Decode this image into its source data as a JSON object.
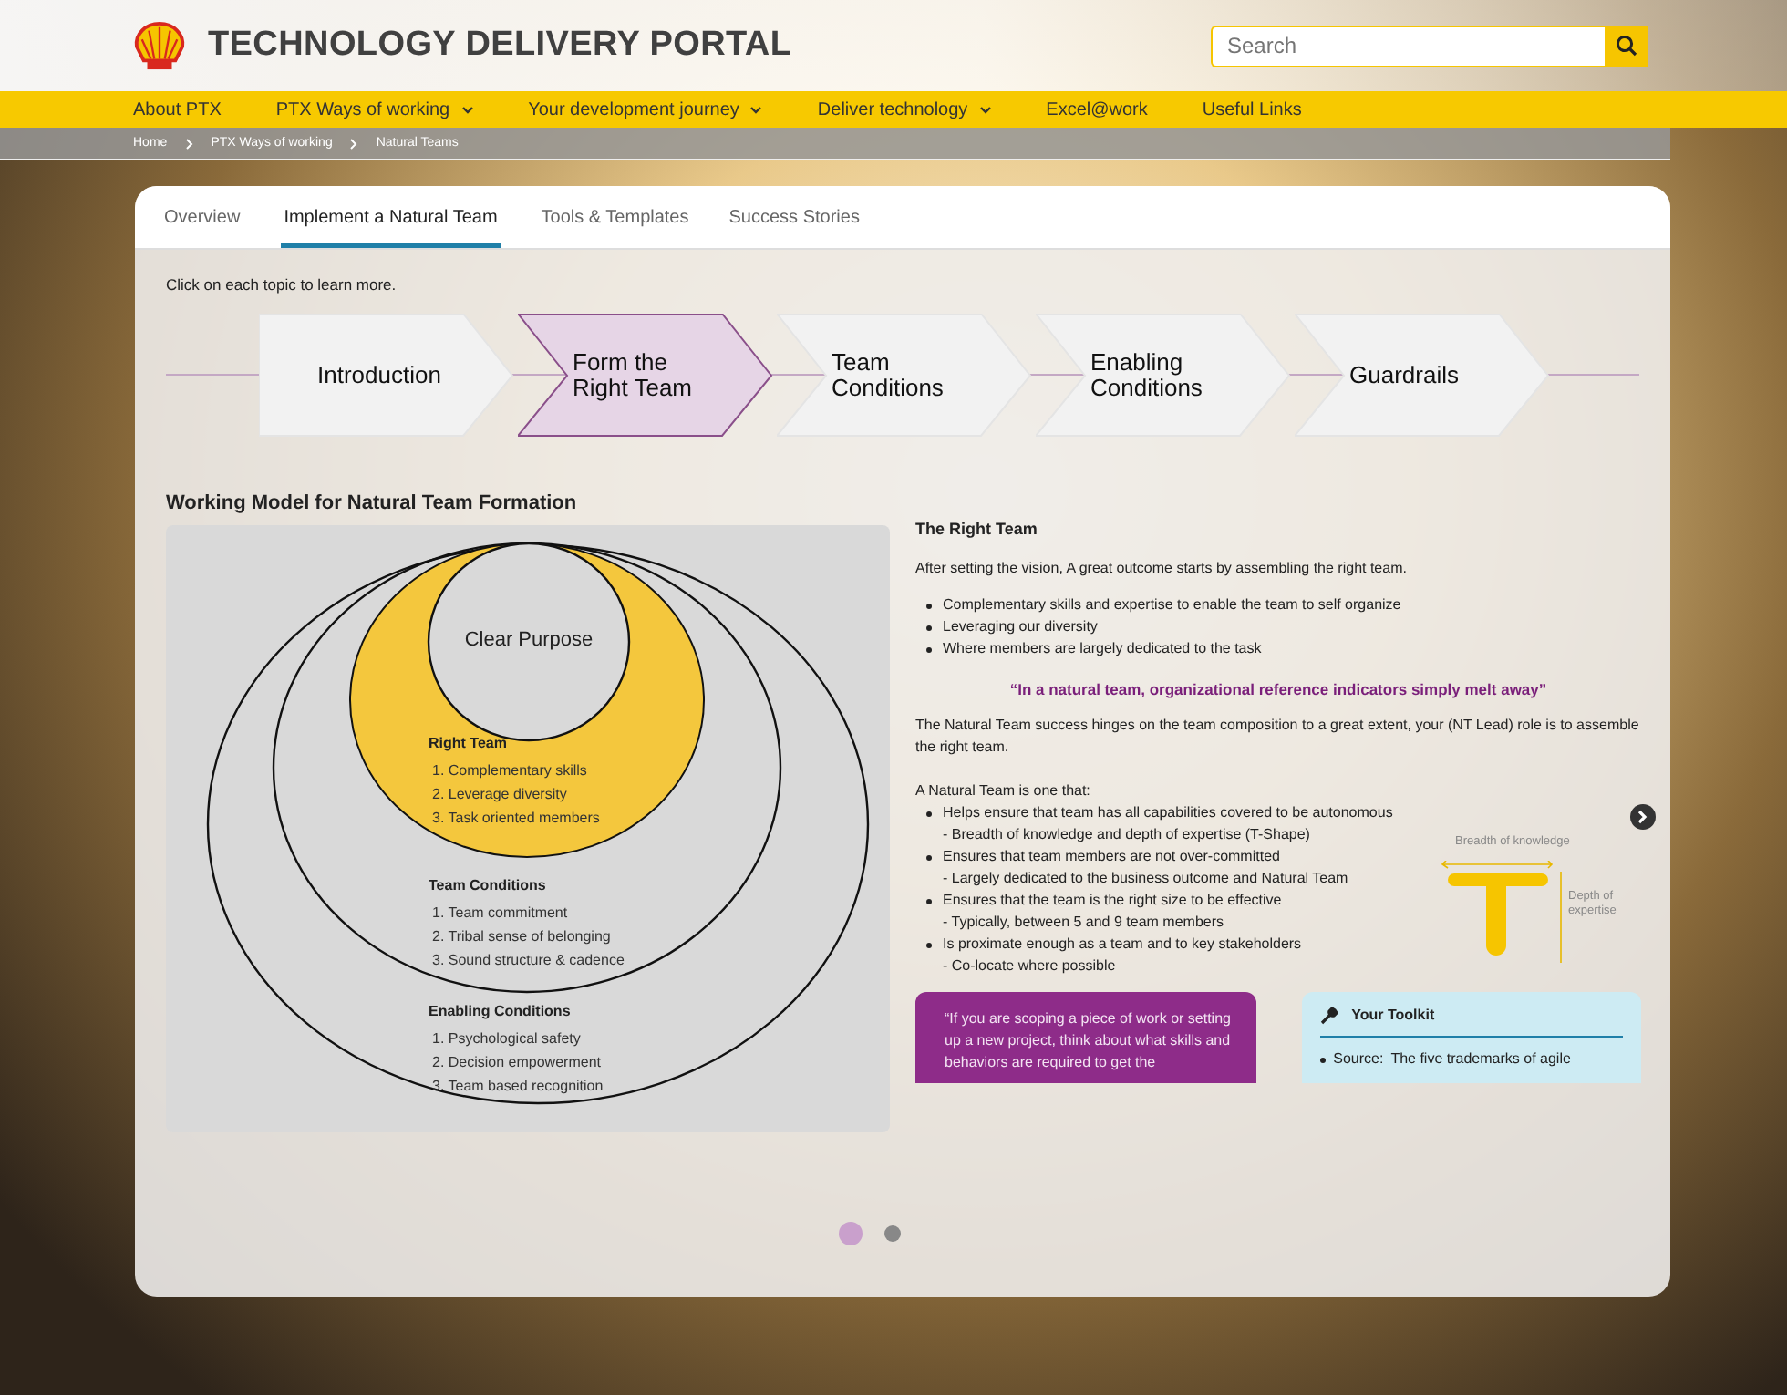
{
  "header": {
    "title": "TECHNOLOGY DELIVERY PORTAL",
    "search": {
      "placeholder": "Search"
    }
  },
  "nav": [
    {
      "label": "About PTX",
      "dropdown": false
    },
    {
      "label": "PTX Ways of working",
      "dropdown": true
    },
    {
      "label": "Your development journey",
      "dropdown": true
    },
    {
      "label": "Deliver technology",
      "dropdown": true
    },
    {
      "label": "Excel@work",
      "dropdown": false
    },
    {
      "label": "Useful Links",
      "dropdown": false
    }
  ],
  "breadcrumb": [
    "Home",
    "PTX Ways of working",
    "Natural Teams"
  ],
  "tabs": [
    {
      "label": "Overview",
      "selected": false
    },
    {
      "label": "Implement a Natural Team",
      "selected": true
    },
    {
      "label": "Tools & Templates",
      "selected": false
    },
    {
      "label": "Success Stories",
      "selected": false
    }
  ],
  "instruction": "Click on each topic to learn more.",
  "steps": [
    {
      "label": "Introduction",
      "selected": false
    },
    {
      "label": "Form the Right Team",
      "selected": true
    },
    {
      "label": "Team Conditions",
      "selected": false
    },
    {
      "label": "Enabling Conditions",
      "selected": false
    },
    {
      "label": "Guardrails",
      "selected": false
    }
  ],
  "model": {
    "title": "Working Model for Natural Team Formation",
    "center": "Clear Purpose",
    "rings": [
      {
        "heading": "Right Team",
        "items": [
          "1. Complementary skills",
          "2. Leverage diversity",
          "3. Task oriented members"
        ]
      },
      {
        "heading": "Team Conditions",
        "items": [
          "1. Team commitment",
          "2. Tribal sense of belonging",
          "3. Sound structure & cadence"
        ]
      },
      {
        "heading": "Enabling Conditions",
        "items": [
          "1. Psychological safety",
          "2. Decision empowerment",
          "3. Team based recognition"
        ]
      }
    ]
  },
  "detail": {
    "heading": "The Right Team",
    "intro": "After setting the vision, A great outcome starts by assembling the right team.",
    "bullets": [
      "Complementary skills and expertise to enable the team to self organize",
      "Leveraging our diversity",
      "Where members are largely dedicated to the task"
    ],
    "quote": "“In a natural team, organizational reference indicators simply melt away”",
    "paragraph": "The Natural Team success hinges on the team composition to a great extent, your (NT Lead) role is to assemble the right team.",
    "list_title": "A Natural Team is one that:",
    "criteria": [
      {
        "text": "Helps ensure that team has all capabilities covered to be autonomous",
        "note": "- Breadth of knowledge and depth of expertise (T-Shape)"
      },
      {
        "text": "Ensures that team members are not over-committed",
        "note": "- Largely dedicated to the business outcome and Natural Team"
      },
      {
        "text": "Ensures that the team is the right size to be effective",
        "note": "- Typically, between 5 and 9 team members"
      },
      {
        "text": "Is proximate enough as a team and to key stakeholders",
        "note": "- Co-locate where possible"
      }
    ],
    "t_shape": {
      "breadth": "Breadth of knowledge",
      "depth": "Depth of expertise"
    },
    "callout": "“If you are scoping a piece of work or setting up a new project, think about what skills and behaviors are required to get the",
    "toolkit": {
      "title": "Your Toolkit",
      "source_label": "Source:",
      "source_link": "The five trademarks of agile"
    }
  },
  "pager": [
    {
      "selected": true
    },
    {
      "selected": false
    }
  ]
}
